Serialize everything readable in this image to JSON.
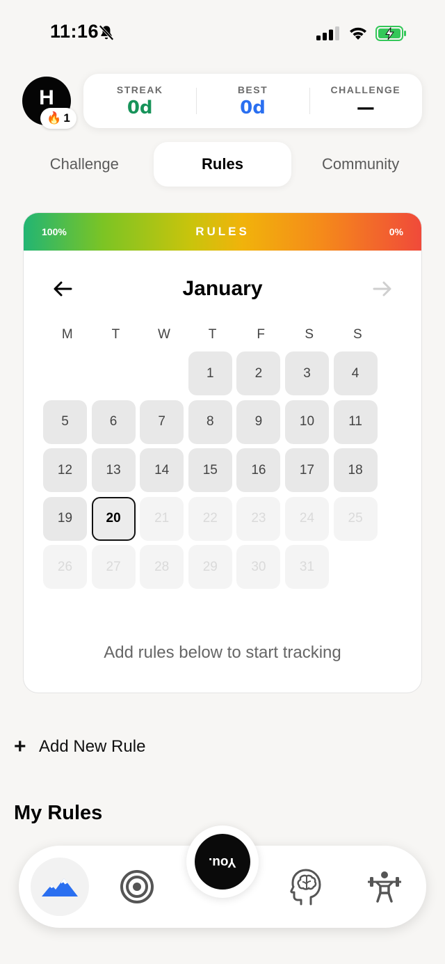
{
  "status_bar": {
    "time": "11:16"
  },
  "profile": {
    "avatar_letter": "H",
    "badge_emoji": "🔥",
    "badge_count": "1"
  },
  "stats": {
    "streak_label": "STREAK",
    "streak_value": "0d",
    "best_label": "BEST",
    "best_value": "0d",
    "challenge_label": "CHALLENGE",
    "challenge_value": "—"
  },
  "tabs": [
    {
      "label": "Challenge",
      "active": false
    },
    {
      "label": "Rules",
      "active": true
    },
    {
      "label": "Community",
      "active": false
    }
  ],
  "calendar": {
    "left_pct": "100%",
    "title": "RULES",
    "right_pct": "0%",
    "month": "January",
    "weekdays": [
      "M",
      "T",
      "W",
      "T",
      "F",
      "S",
      "S"
    ],
    "first_weekday_index": 3,
    "days_in_month": 31,
    "today": 20,
    "hint": "Add rules below to start tracking"
  },
  "add_rule_label": "Add New Rule",
  "my_rules_heading": "My Rules",
  "nav": {
    "items": [
      "mountains-icon",
      "target-icon",
      "you-button",
      "brain-icon",
      "weightlifter-icon"
    ],
    "you_label": "You."
  },
  "colors": {
    "streak": "#17935a",
    "best": "#2a6ff0",
    "accent_blue": "#2a6ff0"
  }
}
